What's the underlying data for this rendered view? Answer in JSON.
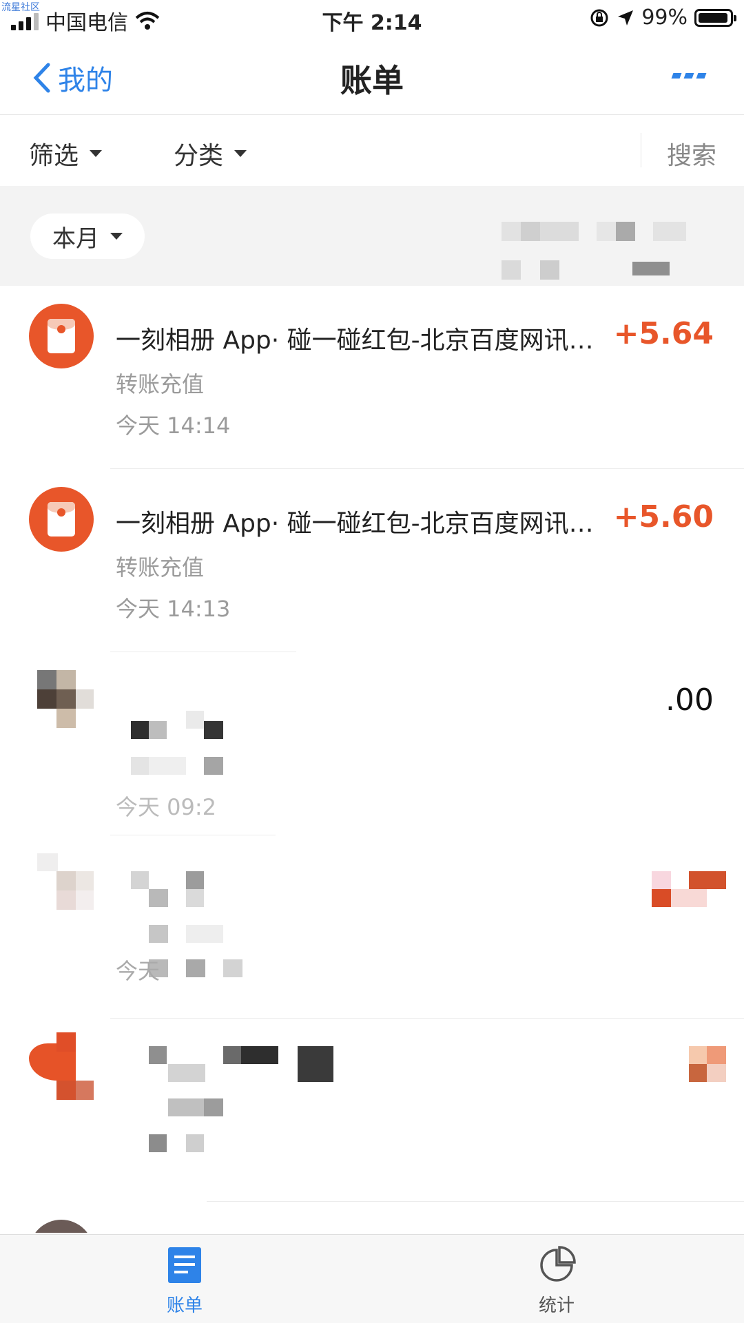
{
  "watermark": "流星社区",
  "status_bar": {
    "carrier": "中国电信",
    "time": "下午 2:14",
    "battery": "99%",
    "battery_level": 0.99
  },
  "nav": {
    "back_label": "我的",
    "title": "账单"
  },
  "filters": {
    "filter_label": "筛选",
    "category_label": "分类",
    "search_label": "搜索"
  },
  "month": {
    "label": "本月"
  },
  "transactions": [
    {
      "title": "一刻相册 App· 碰一碰红包-北京百度网讯科技有限公司",
      "amount": "+5.64",
      "category": "转账充值",
      "time": "今天  14:14"
    },
    {
      "title": "一刻相册 App· 碰一碰红包-北京百度网讯科技有限公司",
      "amount": "+5.60",
      "category": "转账充值",
      "time": "今天  14:13"
    },
    {
      "amount_partial": ".00",
      "time_partial": "今天  09:2"
    },
    {
      "time_partial": "今天"
    }
  ],
  "tabs": {
    "bill": "账单",
    "stats": "统计"
  },
  "colors": {
    "accent": "#2e83e8",
    "income": "#e8562a"
  }
}
